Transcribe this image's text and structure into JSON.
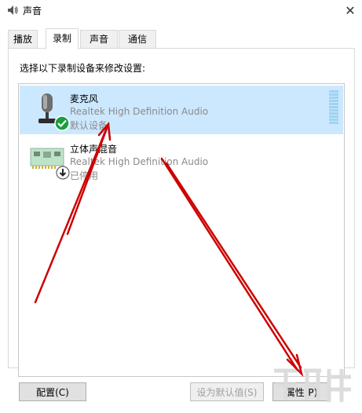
{
  "window": {
    "title": "声音",
    "close_label": "✕"
  },
  "tabs": [
    {
      "label": "播放",
      "active": false
    },
    {
      "label": "录制",
      "active": true
    },
    {
      "label": "声音",
      "active": false
    },
    {
      "label": "通信",
      "active": false
    }
  ],
  "instruction": "选择以下录制设备来修改设置:",
  "devices": [
    {
      "name": "麦克风",
      "driver": "Realtek High Definition Audio",
      "status": "默认设备",
      "selected": true,
      "icon": "microphone-icon",
      "badge": "default-check-icon"
    },
    {
      "name": "立体声混音",
      "driver": "Realtek High Definition Audio",
      "status": "已停用",
      "selected": false,
      "icon": "stereo-mix-card-icon",
      "badge": "disabled-down-arrow-icon"
    }
  ],
  "buttons": {
    "configure": "配置(C)",
    "set_default": "设为默认值(S)",
    "properties": "属性(P)"
  },
  "colors": {
    "selection": "#cce8ff",
    "arrow": "#cc0000",
    "check": "#1a9e3e"
  }
}
